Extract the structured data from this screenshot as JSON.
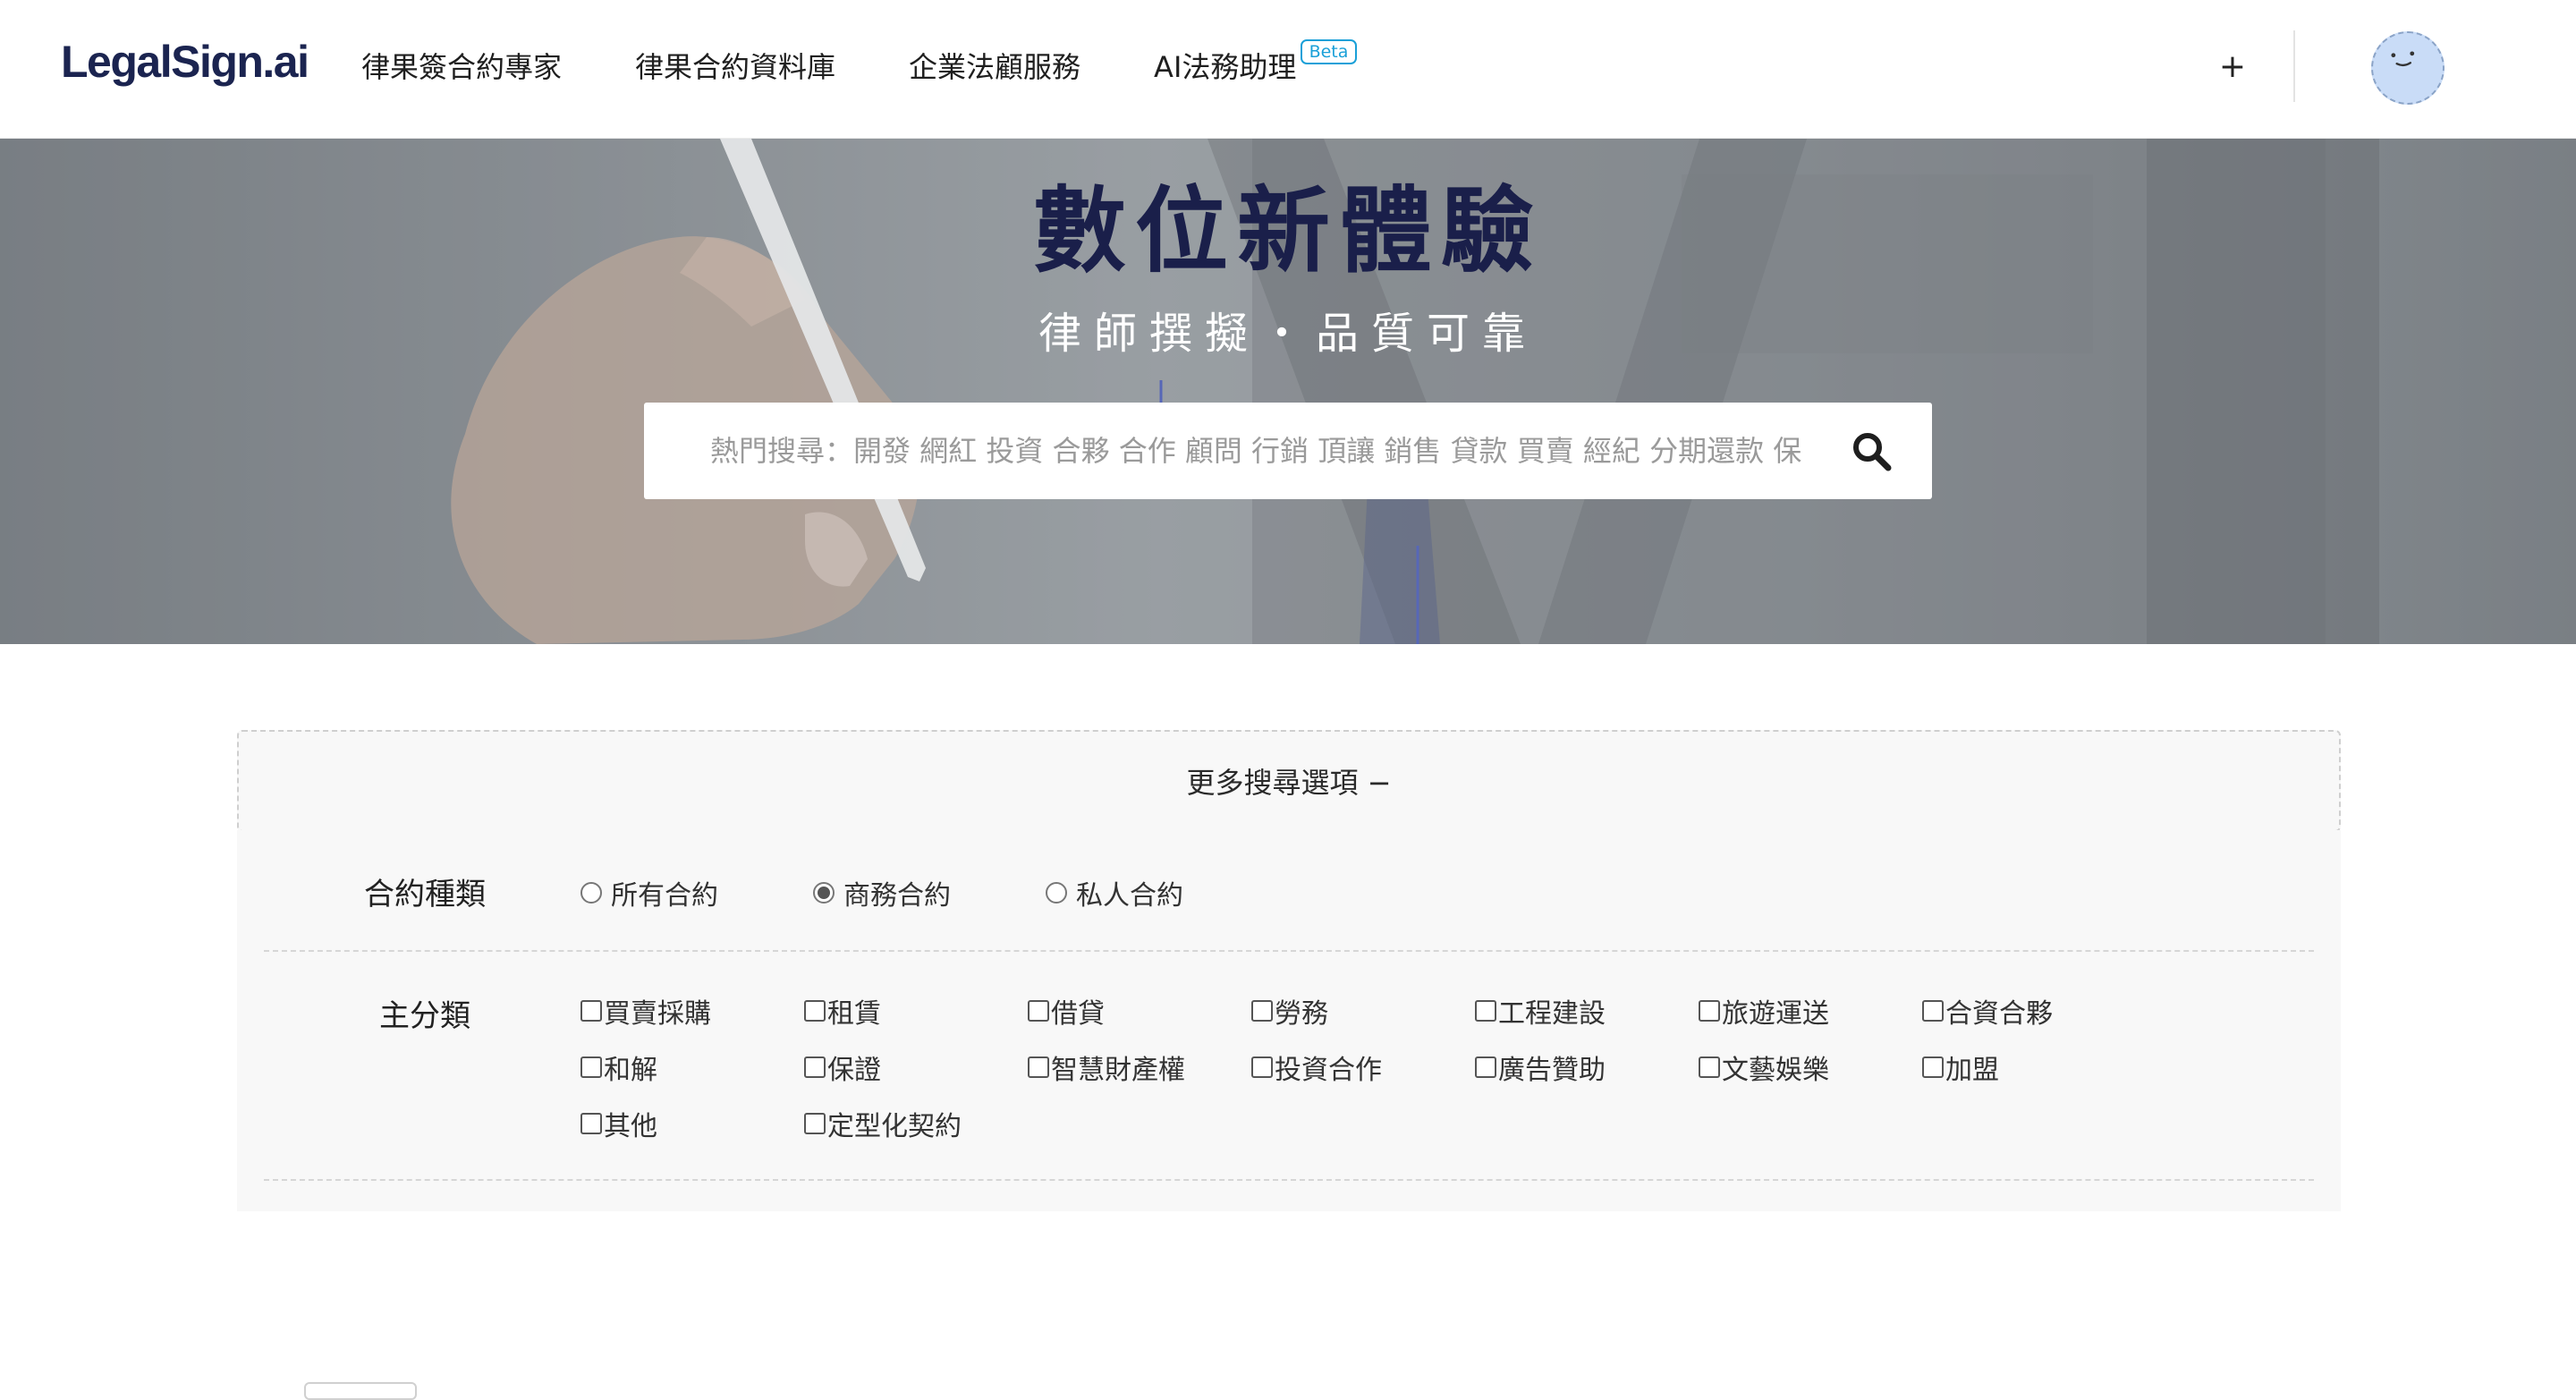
{
  "header": {
    "logo": "LegalSign.ai",
    "nav": [
      {
        "label": "律果簽合約專家"
      },
      {
        "label": "律果合約資料庫"
      },
      {
        "label": "企業法顧服務"
      },
      {
        "label": "AI法務助理",
        "badge": "Beta"
      }
    ],
    "plus_label": "+",
    "avatar_icon": "smiley-face-icon"
  },
  "hero": {
    "title": "數位新體驗",
    "subtitle": "律師撰擬・品質可靠",
    "search": {
      "placeholder": "熱門搜尋：開發 網紅 投資 合夥 合作 顧問 行銷 頂讓 銷售 貸款 買賣 經紀 分期還款 保",
      "icon": "search-icon"
    }
  },
  "filters": {
    "toggle_label": "更多搜尋選項 −",
    "contract_type": {
      "label": "合約種類",
      "options": [
        "所有合約",
        "商務合約",
        "私人合約"
      ],
      "selected": "商務合約"
    },
    "main_category": {
      "label": "主分類",
      "options": [
        "買賣採購",
        "租賃",
        "借貸",
        "勞務",
        "工程建設",
        "旅遊運送",
        "合資合夥",
        "和解",
        "保證",
        "智慧財產權",
        "投資合作",
        "廣告贊助",
        "文藝娛樂",
        "加盟",
        "其他",
        "定型化契約"
      ]
    }
  },
  "colors": {
    "title": "#1a1f4a",
    "badge": "#1aa0d8",
    "panel_bg": "#f8f8f8"
  }
}
